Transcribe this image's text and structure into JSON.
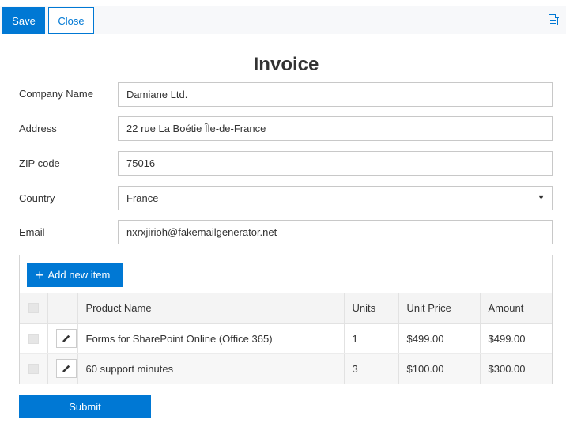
{
  "toolbar": {
    "save_label": "Save",
    "close_label": "Close",
    "export_icon": "pdf-export-icon"
  },
  "form": {
    "title": "Invoice",
    "fields": [
      {
        "label": "Company Name",
        "value": "Damiane Ltd."
      },
      {
        "label": "Address",
        "value": "22 rue La Boétie Île-de-France"
      },
      {
        "label": "ZIP code",
        "value": "75016"
      },
      {
        "label": "Country",
        "value": "France"
      },
      {
        "label": "Email",
        "value": "nxrxjirioh@fakemailgenerator.net"
      }
    ]
  },
  "items": {
    "add_label": "Add new item",
    "columns": [
      "Product Name",
      "Units",
      "Unit Price",
      "Amount"
    ],
    "rows": [
      {
        "product": "Forms for SharePoint Online (Office 365)",
        "units": "1",
        "unit_price": "$499.00",
        "amount": "$499.00"
      },
      {
        "product": "60 support minutes",
        "units": "3",
        "unit_price": "$100.00",
        "amount": "$300.00"
      }
    ]
  },
  "submit_label": "Submit",
  "colors": {
    "accent": "#0078d4",
    "toolbar_bg": "#f7f8fa",
    "header_bg": "#f4f4f4"
  }
}
